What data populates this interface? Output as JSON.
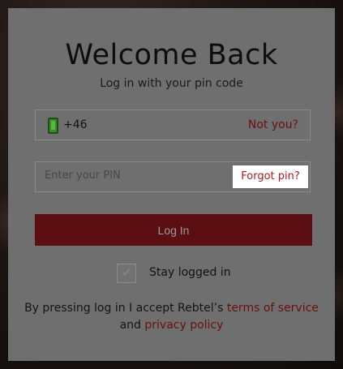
{
  "header": {
    "title": "Welcome Back",
    "subtitle": "Log in with your pin code"
  },
  "phone_field": {
    "icon": "mobile-phone-icon",
    "value": "+46",
    "not_you_link": "Not you?"
  },
  "pin_field": {
    "placeholder": "Enter your PIN",
    "forgot_link": "Forgot pin?"
  },
  "login_button": {
    "label": "Log In"
  },
  "stay_logged_in": {
    "label": "Stay logged in",
    "checked": true
  },
  "terms": {
    "prefix": "By pressing log in I accept Rebtel’s",
    "terms_link": "terms of service",
    "conjunction": "and",
    "privacy_link": "privacy policy"
  },
  "colors": {
    "modal_bg": "#6f6f6f",
    "accent": "#5c0f12",
    "link": "#a51c24"
  }
}
